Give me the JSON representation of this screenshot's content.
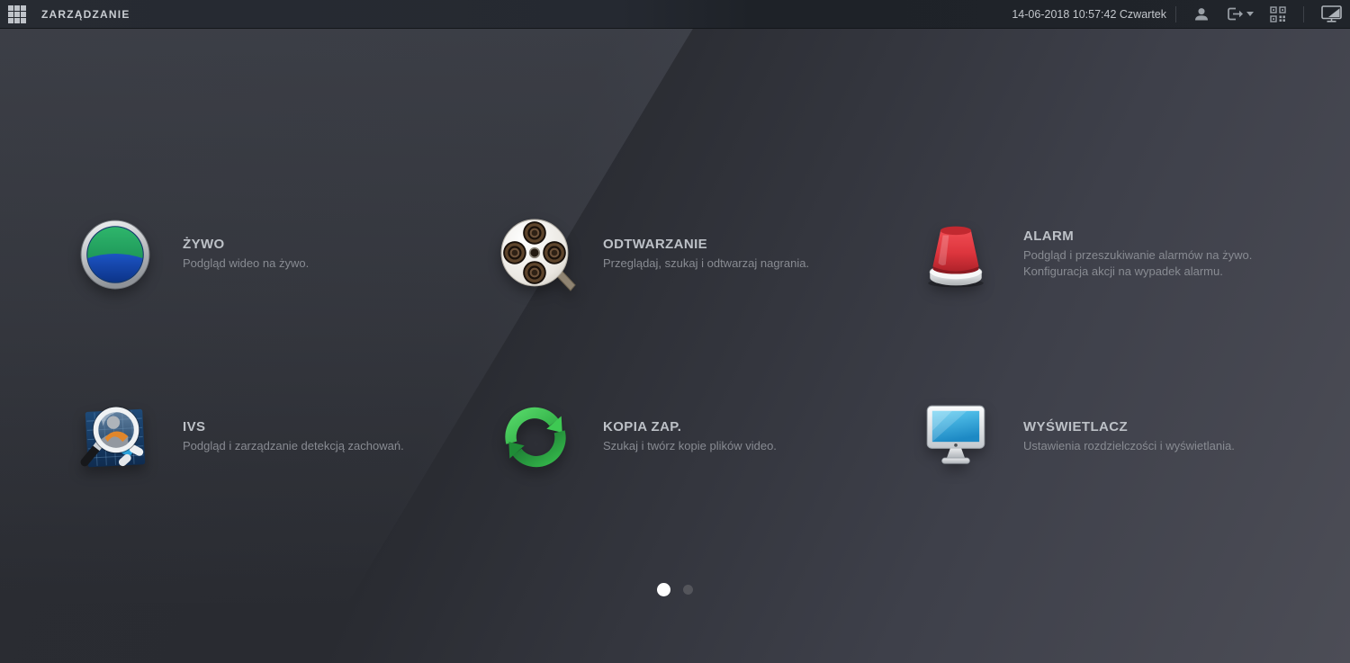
{
  "header": {
    "title": "ZARZĄDZANIE",
    "datetime": "14-06-2018 10:57:42 Czwartek",
    "icons": {
      "menu": "grid-menu-icon",
      "user": "user-icon",
      "logout": "logout-icon",
      "qr": "qr-code-icon",
      "display_toggle": "monitor-output-icon"
    }
  },
  "tiles": [
    {
      "id": "zywo",
      "icon": "live-lens-icon",
      "title": "ŻYWO",
      "description": [
        "Podgląd wideo na żywo."
      ]
    },
    {
      "id": "odtwarzanie",
      "icon": "film-reel-icon",
      "title": "ODTWARZANIE",
      "description": [
        "Przeglądaj, szukaj i odtwarzaj nagrania."
      ]
    },
    {
      "id": "alarm",
      "icon": "siren-icon",
      "title": "ALARM",
      "description": [
        "Podgląd i przeszukiwanie alarmów na żywo.",
        "Konfiguracja akcji na wypadek alarmu."
      ]
    },
    {
      "id": "ivs",
      "icon": "magnifier-person-icon",
      "title": "IVS",
      "description": [
        "Podgląd i zarządzanie detekcją zachowań."
      ]
    },
    {
      "id": "kopia-zap",
      "icon": "sync-arrows-icon",
      "title": "KOPIA ZAP.",
      "description": [
        "Szukaj i twórz kopie plików video."
      ]
    },
    {
      "id": "wyswietlacz",
      "icon": "monitor-icon",
      "title": "WYŚWIETLACZ",
      "description": [
        "Ustawienia rozdzielczości i wyświetlania."
      ]
    }
  ],
  "pagination": {
    "pages": 2,
    "active_page": 1
  },
  "colors": {
    "background_dark": "#2a2c32",
    "background_light": "#4c4d56",
    "topbar": "#23272e",
    "title_text": "#bdc1c7",
    "description_text": "#888b92",
    "live_green": "#2eb56b",
    "live_blue": "#1c54c4",
    "alarm_red": "#e23e46",
    "backup_green": "#3ec953",
    "screen_cyan": "#4cc4ea",
    "active_dot": "#ffffff"
  }
}
